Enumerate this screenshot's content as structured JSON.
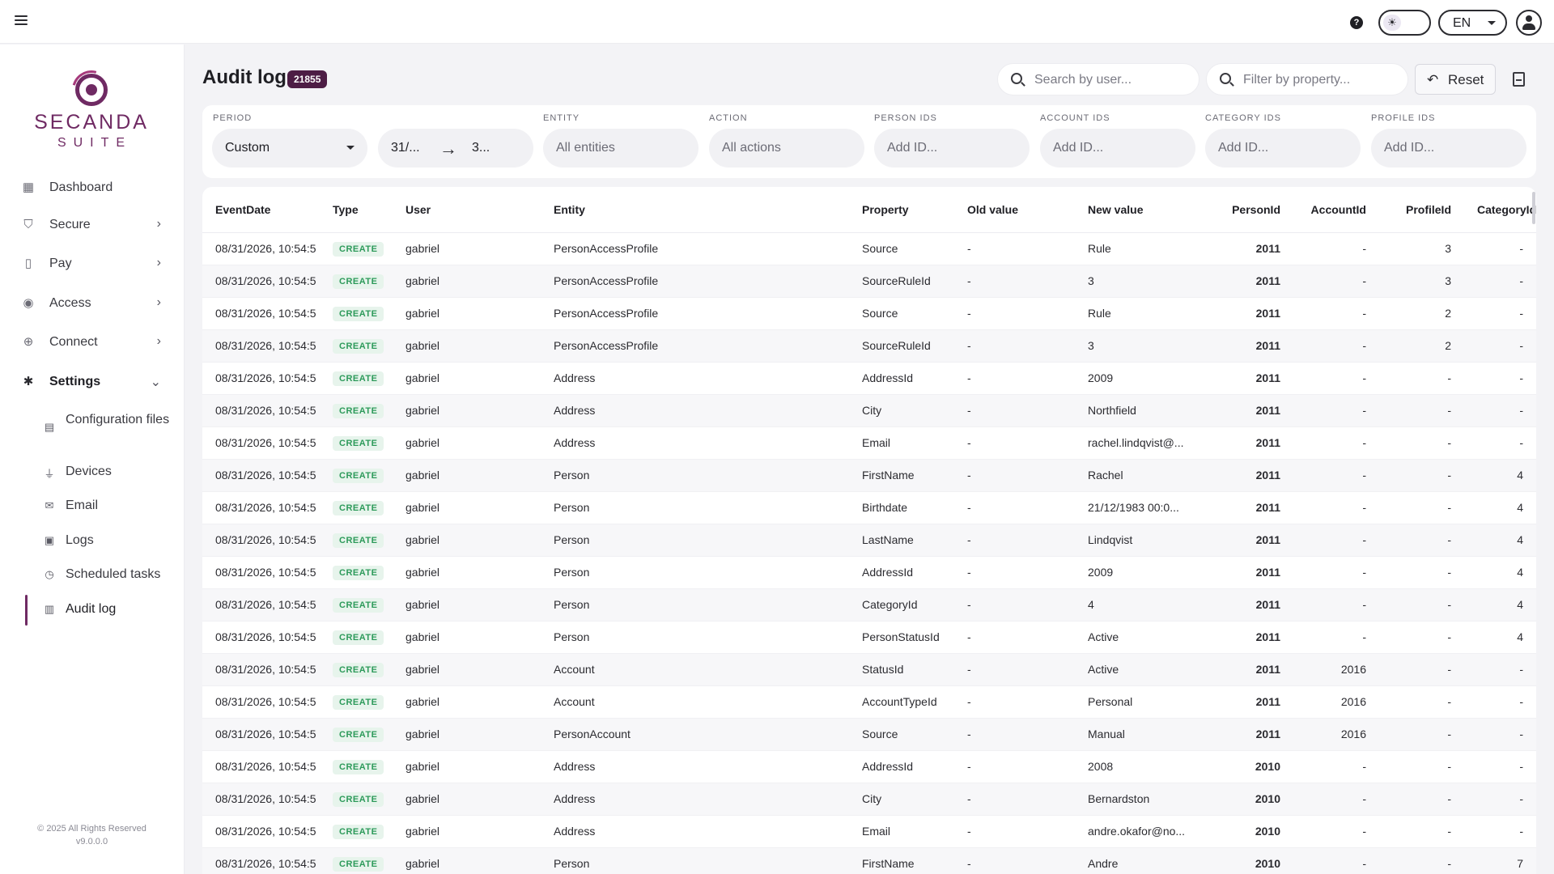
{
  "topbar": {
    "theme_icon": "☀",
    "language": "EN"
  },
  "sidebar": {
    "brand": "SECANDA",
    "suite": "SUITE",
    "items": [
      {
        "label": "Dashboard",
        "icon": "dashboard-icon",
        "glyph": "▦"
      },
      {
        "label": "Secure",
        "icon": "shield-icon",
        "glyph": "⛉"
      },
      {
        "label": "Pay",
        "icon": "pay-icon",
        "glyph": "▯"
      },
      {
        "label": "Access",
        "icon": "lock-icon",
        "glyph": "◉"
      },
      {
        "label": "Connect",
        "icon": "globe-icon",
        "glyph": "⊕"
      },
      {
        "label": "Settings",
        "icon": "gear-icon",
        "glyph": "✱"
      }
    ],
    "settings_children": [
      {
        "label": "Configuration files",
        "icon": "file-icon",
        "glyph": "▤"
      },
      {
        "label": "Devices",
        "icon": "plug-icon",
        "glyph": "⏚"
      },
      {
        "label": "Email",
        "icon": "mail-icon",
        "glyph": "✉"
      },
      {
        "label": "Logs",
        "icon": "logs-icon",
        "glyph": "▣"
      },
      {
        "label": "Scheduled tasks",
        "icon": "clock-icon",
        "glyph": "◷"
      },
      {
        "label": "Audit log",
        "icon": "clipboard-icon",
        "glyph": "▥"
      }
    ],
    "footer_copyright": "© 2025 All Rights Reserved",
    "footer_version": "v9.0.0.0"
  },
  "header": {
    "title": "Audit log",
    "count": "21855",
    "search_user_placeholder": "Search by user...",
    "filter_property_placeholder": "Filter by property...",
    "reset_label": "Reset"
  },
  "filters": {
    "period_label": "PERIOD",
    "period_value": "Custom",
    "date_from": "31/...",
    "date_to": "3...",
    "entity_label": "ENTITY",
    "entity_value": "All entities",
    "action_label": "ACTION",
    "action_value": "All actions",
    "person_ids_label": "PERSON IDS",
    "account_ids_label": "ACCOUNT IDS",
    "category_ids_label": "CATEGORY IDS",
    "profile_ids_label": "PROFILE IDS",
    "id_placeholder": "Add ID..."
  },
  "table": {
    "columns": [
      "EventDate",
      "Type",
      "User",
      "Entity",
      "Property",
      "Old value",
      "New value",
      "PersonId",
      "AccountId",
      "ProfileId",
      "CategoryId"
    ],
    "rows": [
      [
        "08/31/2026, 10:54:5",
        "CREATE",
        "gabriel",
        "PersonAccessProfile",
        "Source",
        "-",
        "Rule",
        "2011",
        "-",
        "3",
        "-"
      ],
      [
        "08/31/2026, 10:54:5",
        "CREATE",
        "gabriel",
        "PersonAccessProfile",
        "SourceRuleId",
        "-",
        "3",
        "2011",
        "-",
        "3",
        "-"
      ],
      [
        "08/31/2026, 10:54:5",
        "CREATE",
        "gabriel",
        "PersonAccessProfile",
        "Source",
        "-",
        "Rule",
        "2011",
        "-",
        "2",
        "-"
      ],
      [
        "08/31/2026, 10:54:5",
        "CREATE",
        "gabriel",
        "PersonAccessProfile",
        "SourceRuleId",
        "-",
        "3",
        "2011",
        "-",
        "2",
        "-"
      ],
      [
        "08/31/2026, 10:54:5",
        "CREATE",
        "gabriel",
        "Address",
        "AddressId",
        "-",
        "2009",
        "2011",
        "-",
        "-",
        "-"
      ],
      [
        "08/31/2026, 10:54:5",
        "CREATE",
        "gabriel",
        "Address",
        "City",
        "-",
        "Northfield",
        "2011",
        "-",
        "-",
        "-"
      ],
      [
        "08/31/2026, 10:54:5",
        "CREATE",
        "gabriel",
        "Address",
        "Email",
        "-",
        "rachel.lindqvist@...",
        "2011",
        "-",
        "-",
        "-"
      ],
      [
        "08/31/2026, 10:54:5",
        "CREATE",
        "gabriel",
        "Person",
        "FirstName",
        "-",
        "Rachel",
        "2011",
        "-",
        "-",
        "4"
      ],
      [
        "08/31/2026, 10:54:5",
        "CREATE",
        "gabriel",
        "Person",
        "Birthdate",
        "-",
        "21/12/1983 00:0...",
        "2011",
        "-",
        "-",
        "4"
      ],
      [
        "08/31/2026, 10:54:5",
        "CREATE",
        "gabriel",
        "Person",
        "LastName",
        "-",
        "Lindqvist",
        "2011",
        "-",
        "-",
        "4"
      ],
      [
        "08/31/2026, 10:54:5",
        "CREATE",
        "gabriel",
        "Person",
        "AddressId",
        "-",
        "2009",
        "2011",
        "-",
        "-",
        "4"
      ],
      [
        "08/31/2026, 10:54:5",
        "CREATE",
        "gabriel",
        "Person",
        "CategoryId",
        "-",
        "4",
        "2011",
        "-",
        "-",
        "4"
      ],
      [
        "08/31/2026, 10:54:5",
        "CREATE",
        "gabriel",
        "Person",
        "PersonStatusId",
        "-",
        "Active",
        "2011",
        "-",
        "-",
        "4"
      ],
      [
        "08/31/2026, 10:54:5",
        "CREATE",
        "gabriel",
        "Account",
        "StatusId",
        "-",
        "Active",
        "2011",
        "2016",
        "-",
        "-"
      ],
      [
        "08/31/2026, 10:54:5",
        "CREATE",
        "gabriel",
        "Account",
        "AccountTypeId",
        "-",
        "Personal",
        "2011",
        "2016",
        "-",
        "-"
      ],
      [
        "08/31/2026, 10:54:5",
        "CREATE",
        "gabriel",
        "PersonAccount",
        "Source",
        "-",
        "Manual",
        "2011",
        "2016",
        "-",
        "-"
      ],
      [
        "08/31/2026, 10:54:5",
        "CREATE",
        "gabriel",
        "Address",
        "AddressId",
        "-",
        "2008",
        "2010",
        "-",
        "-",
        "-"
      ],
      [
        "08/31/2026, 10:54:5",
        "CREATE",
        "gabriel",
        "Address",
        "City",
        "-",
        "Bernardston",
        "2010",
        "-",
        "-",
        "-"
      ],
      [
        "08/31/2026, 10:54:5",
        "CREATE",
        "gabriel",
        "Address",
        "Email",
        "-",
        "andre.okafor@no...",
        "2010",
        "-",
        "-",
        "-"
      ],
      [
        "08/31/2026, 10:54:5",
        "CREATE",
        "gabriel",
        "Person",
        "FirstName",
        "-",
        "Andre",
        "2010",
        "-",
        "-",
        "7"
      ]
    ]
  },
  "colors": {
    "brand": "#6f2a63",
    "badge": "#4d1d45",
    "create_chip_bg": "#e7f4ec",
    "create_chip_text": "#2d9a5a"
  }
}
